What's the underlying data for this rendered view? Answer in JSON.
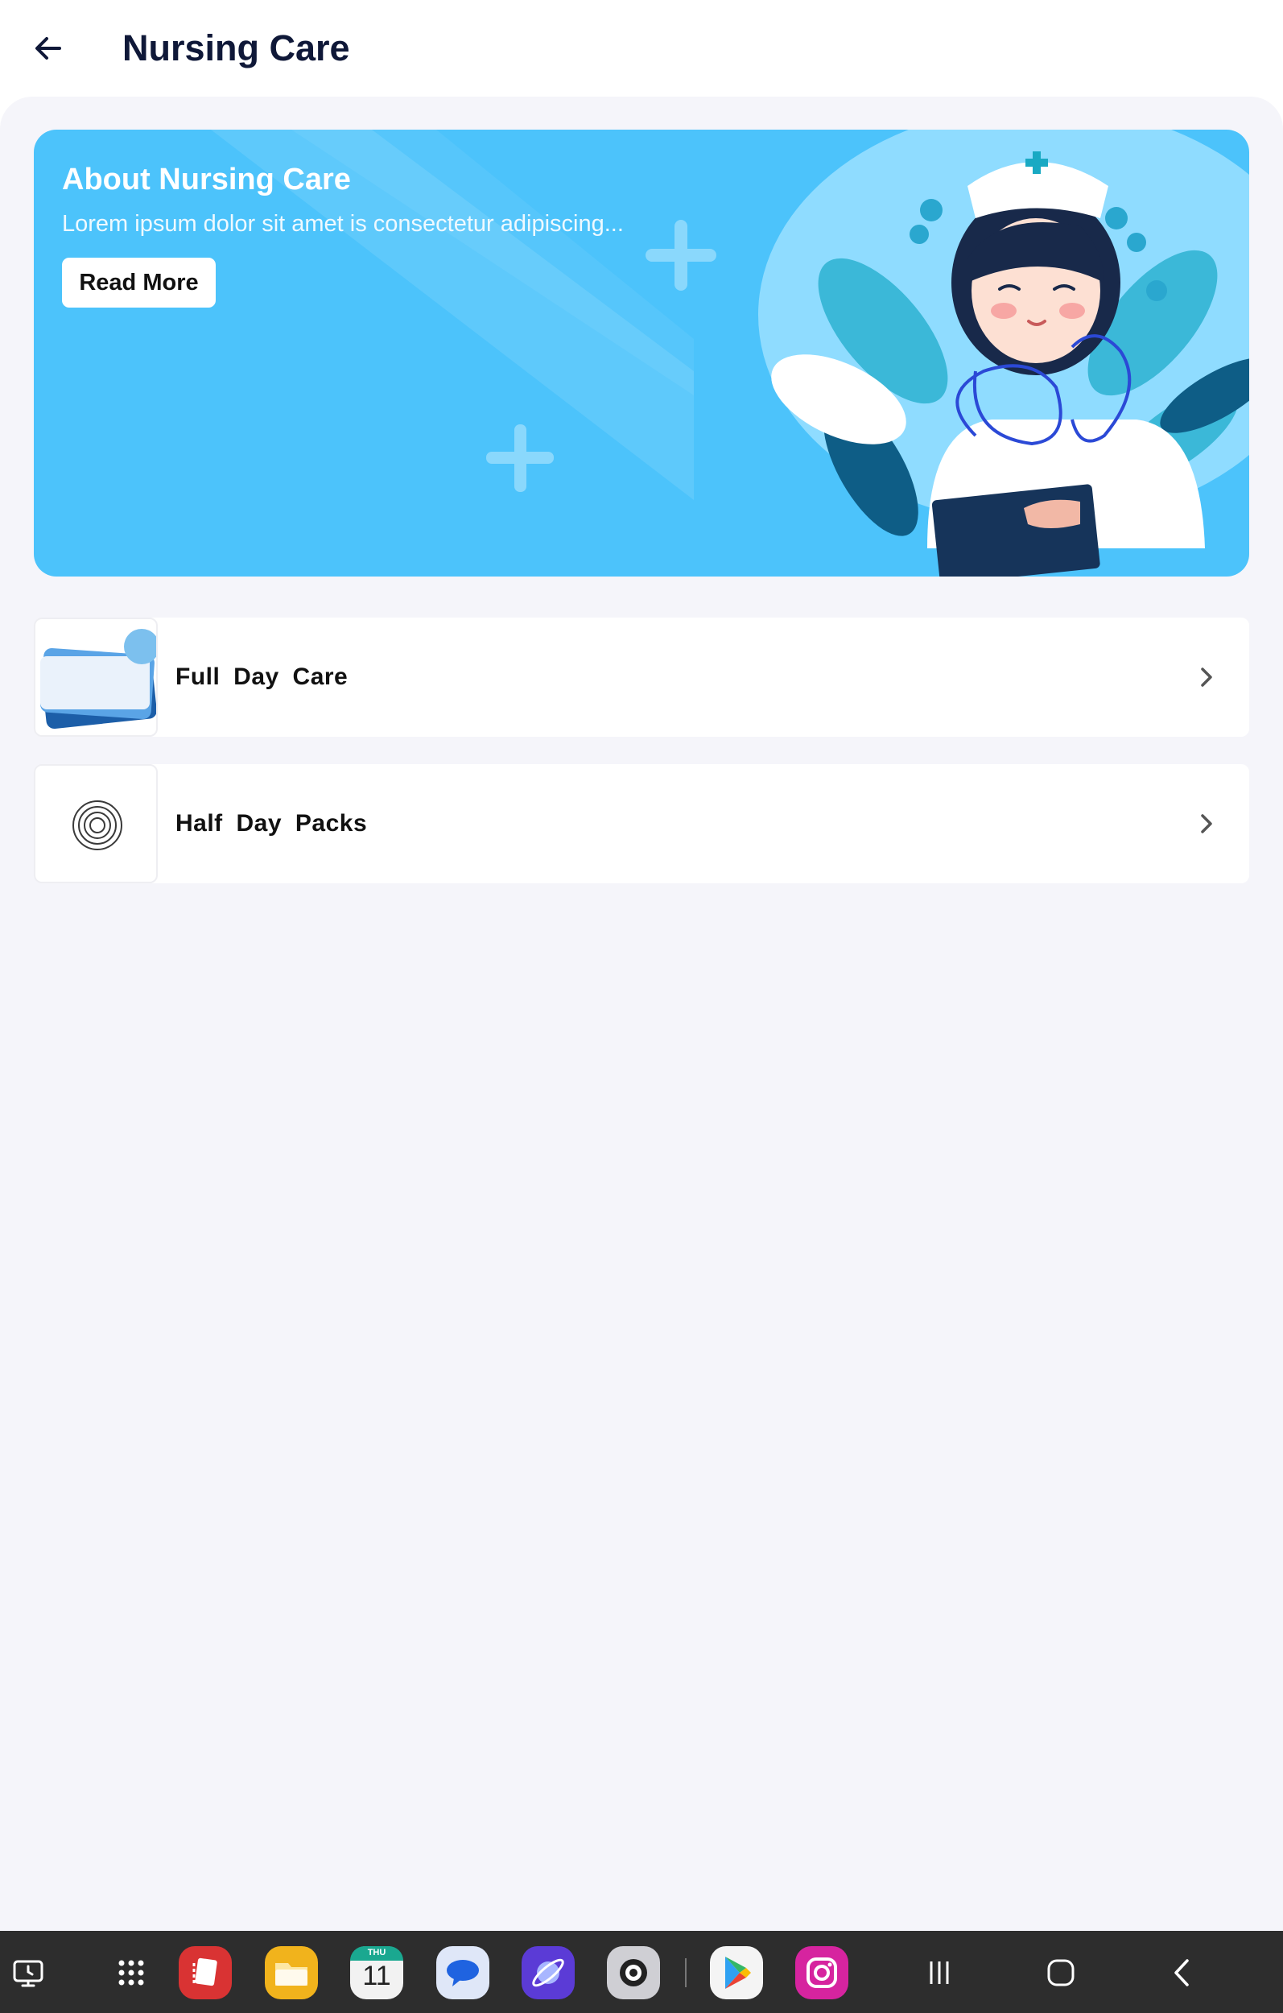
{
  "header": {
    "title": "Nursing Care"
  },
  "banner": {
    "title": "About Nursing Care",
    "text": "Lorem ipsum dolor sit amet is consectetur adipiscing...",
    "button_label": "Read More"
  },
  "services": [
    {
      "label": "Full  Day  Care",
      "icon": "document-cards-icon"
    },
    {
      "label": "Half Day  Packs",
      "icon": "concentric-circles-icon"
    }
  ],
  "taskbar": {
    "calendar_day": "THU",
    "calendar_date": "11",
    "apps": [
      "screen-icon",
      "app-drawer-icon",
      "notes-app-icon",
      "files-app-icon",
      "calendar-app-icon",
      "messages-app-icon",
      "browser-app-icon",
      "camera-app-icon",
      "play-store-icon",
      "instagram-icon"
    ],
    "nav": [
      "recents-icon",
      "home-icon",
      "back-nav-icon"
    ]
  },
  "colors": {
    "banner": "#4cc3fb",
    "title": "#0f1838",
    "background": "#f5f5fa",
    "taskbar": "#2d2d2d"
  }
}
